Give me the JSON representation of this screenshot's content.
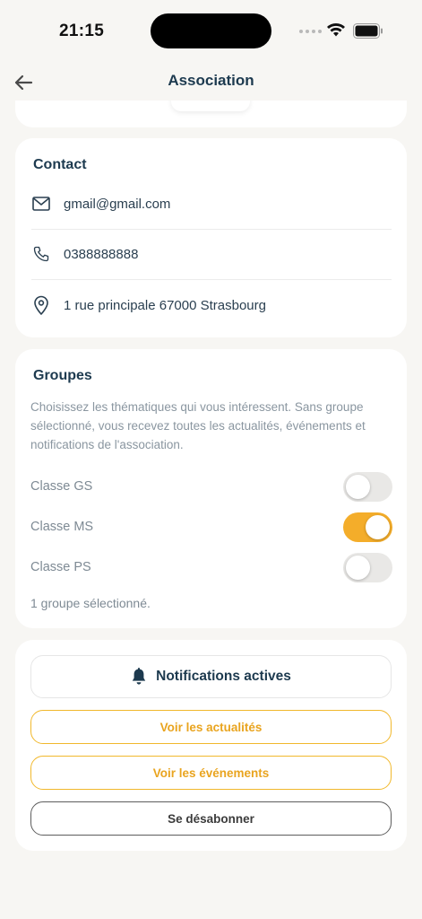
{
  "status_bar": {
    "time": "21:15"
  },
  "header": {
    "title": "Association"
  },
  "contact": {
    "title": "Contact",
    "email": "gmail@gmail.com",
    "phone": "0388888888",
    "address": "1 rue principale 67000 Strasbourg"
  },
  "groups": {
    "title": "Groupes",
    "description": "Choisissez les thématiques qui vous intéressent. Sans groupe sélectionné, vous recevez toutes les actualités, événements et notifications de l'association.",
    "items": [
      {
        "label": "Classe GS",
        "enabled": false
      },
      {
        "label": "Classe MS",
        "enabled": true
      },
      {
        "label": "Classe PS",
        "enabled": false
      }
    ],
    "selected_text": "1 groupe sélectionné."
  },
  "actions": {
    "notifications_label": "Notifications actives",
    "news_label": "Voir les actualités",
    "events_label": "Voir les événements",
    "unsubscribe_label": "Se désabonner"
  },
  "colors": {
    "accent": "#f4ad2a",
    "title": "#1d3a4f",
    "background": "#f7f6f3"
  },
  "icons": {
    "back": "arrow-left-icon",
    "email": "mail-icon",
    "phone": "phone-icon",
    "address": "map-pin-icon",
    "notifications": "bell-icon"
  }
}
